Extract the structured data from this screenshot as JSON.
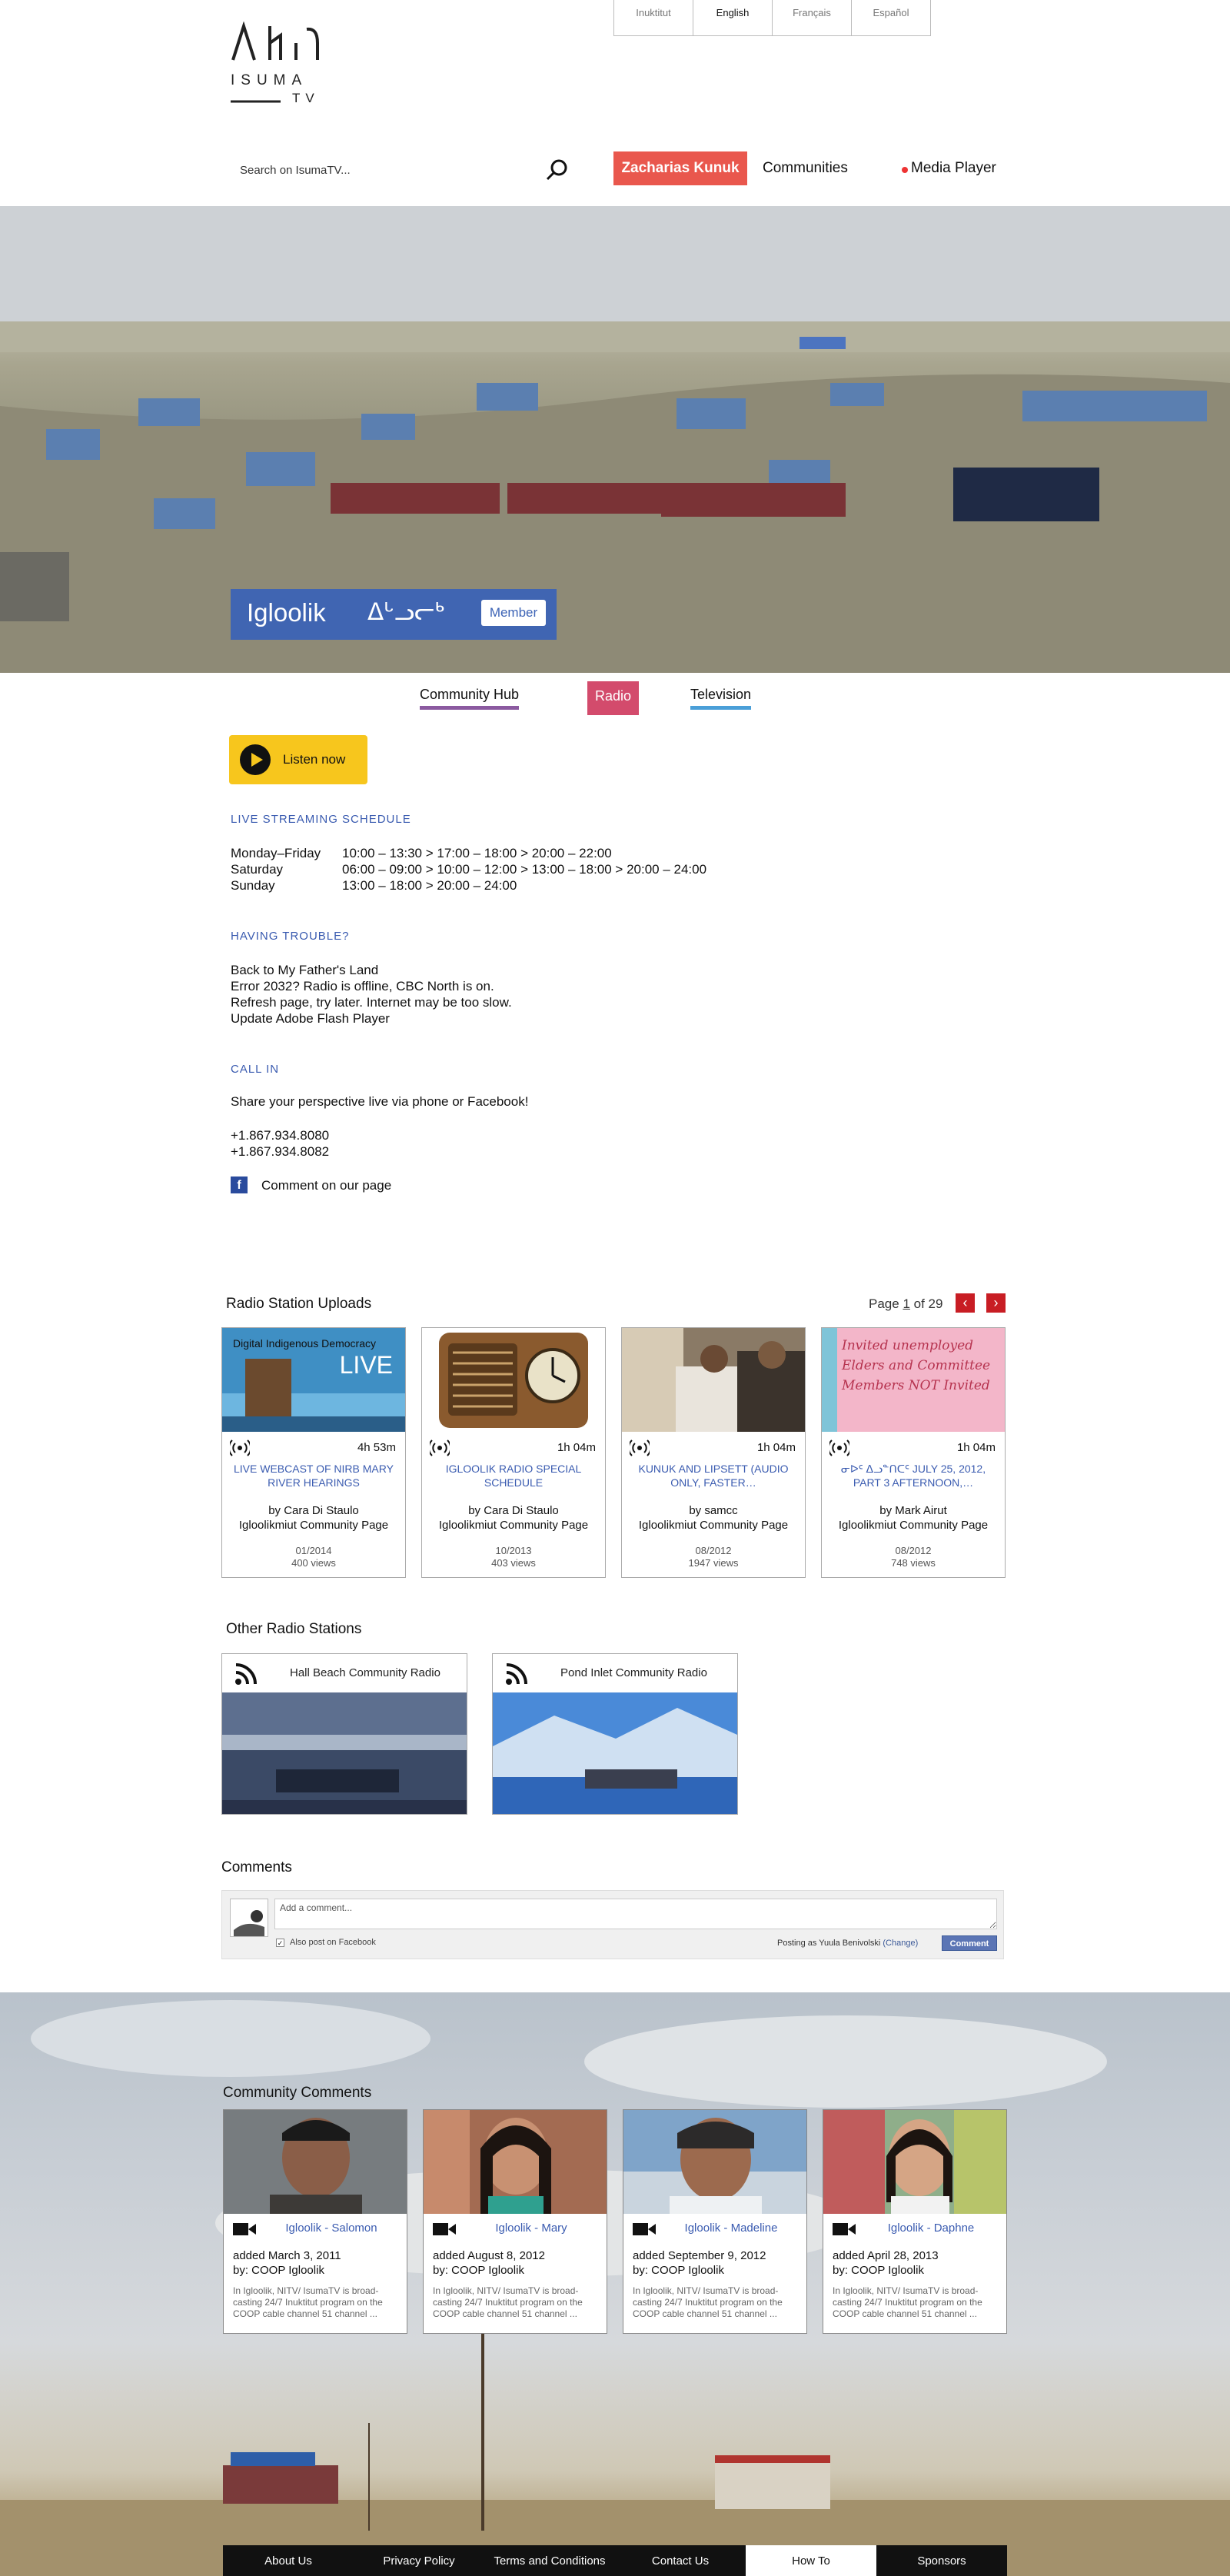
{
  "languages": [
    {
      "label": "Inuktitut",
      "active": false
    },
    {
      "label": "English",
      "active": true
    },
    {
      "label": "Français",
      "active": false
    },
    {
      "label": "Español",
      "active": false
    }
  ],
  "logo": {
    "word": "ISUMA",
    "sub": "TV"
  },
  "search": {
    "placeholder": "Search on IsumaTV..."
  },
  "nav": {
    "user": "Zacharias Kunuk",
    "communities": "Communities",
    "media_player": "Media Player"
  },
  "hero": {
    "title": "Igloolik",
    "syllabics": "ᐃᒡᓗᓕᒃ",
    "member": "Member"
  },
  "tabs": {
    "hub": "Community Hub",
    "radio": "Radio",
    "tv": "Television"
  },
  "listen": {
    "label": "Listen now"
  },
  "schedule": {
    "heading": "LIVE STREAMING SCHEDULE",
    "rows": [
      {
        "day": "Monday–Friday",
        "times": "10:00 – 13:30 > 17:00 – 18:00 > 20:00 – 22:00"
      },
      {
        "day": "Saturday",
        "times": "06:00 – 09:00 > 10:00 – 12:00 > 13:00 – 18:00 > 20:00 – 24:00"
      },
      {
        "day": "Sunday",
        "times": "13:00 – 18:00 > 20:00 – 24:00"
      }
    ]
  },
  "trouble": {
    "heading": "HAVING TROUBLE?",
    "lines": [
      "Back to My Father's Land",
      "Error 2032? Radio is offline, CBC North is on.",
      "Refresh page, try later. Internet may be too slow.",
      "Update Adobe Flash Player"
    ]
  },
  "callin": {
    "heading": "CALL IN",
    "intro": "Share your perspective live via phone or Facebook!",
    "phones": [
      "+1.867.934.8080",
      "+1.867.934.8082"
    ],
    "facebook": "Comment on our page"
  },
  "uploads": {
    "title": "Radio Station Uploads",
    "page_label": "Page",
    "page_current": "1",
    "page_of": "of 29",
    "prev": "‹",
    "next": "›",
    "cards": [
      {
        "thumb_caption": "Digital Indigenous Democracy",
        "thumb_live": "LIVE",
        "duration": "4h 53m",
        "title": "LIVE WEBCAST OF NIRB MARY RIVER HEARINGS",
        "by": "by Cara Di Staulo",
        "community": "Igloolikmiut Community Page",
        "date": "01/2014",
        "views": "400 views"
      },
      {
        "duration": "1h 04m",
        "title": "IGLOOLIK RADIO SPECIAL SCHEDULE",
        "by": "by Cara Di Staulo",
        "community": "Igloolikmiut Community Page",
        "date": "10/2013",
        "views": "403 views"
      },
      {
        "duration": "1h 04m",
        "title": "KUNUK AND LIPSETT (AUDIO ONLY, FASTER…",
        "by": "by samcc",
        "community": "Igloolikmiut Community Page",
        "date": "08/2012",
        "views": "1947 views"
      },
      {
        "thumb_caption": "Invited unemployed Elders and Committee Members NOT Invited",
        "duration": "1h 04m",
        "title": "ᓂᐅᑦ ᐃᓗᓐᑎᑕᑦ JULY 25, 2012, PART 3 AFTERNOON,…",
        "by": "by Mark Airut",
        "community": "Igloolikmiut Community Page",
        "date": "08/2012",
        "views": "748 views"
      }
    ]
  },
  "stations": {
    "title": "Other Radio Stations",
    "items": [
      {
        "name": "Hall Beach Community Radio"
      },
      {
        "name": "Pond Inlet Community Radio"
      }
    ]
  },
  "comments": {
    "title": "Comments",
    "placeholder": "Add a comment...",
    "also_post": "Also post on Facebook",
    "posting_as": "Posting as Yuula Benivolski",
    "change": "(Change)",
    "button": "Comment"
  },
  "community_comments": {
    "title": "Community Comments",
    "items": [
      {
        "name": "Igloolik - Salomon",
        "added": "added March 3, 2011",
        "by": "by: COOP Igloolik",
        "body": "In Igloolik, NITV/ IsumaTV is broad-casting 24/7 Inuktitut program on the COOP cable channel 51 channel ..."
      },
      {
        "name": "Igloolik - Mary",
        "added": "added August 8, 2012",
        "by": "by: COOP Igloolik",
        "body": "In Igloolik, NITV/ IsumaTV is broad-casting 24/7 Inuktitut program on the COOP cable channel 51 channel ..."
      },
      {
        "name": "Igloolik - Madeline",
        "added": "added September  9, 2012",
        "by": "by: COOP Igloolik",
        "body": "In Igloolik, NITV/ IsumaTV is broad-casting 24/7 Inuktitut program on the COOP cable channel 51 channel ..."
      },
      {
        "name": "Igloolik - Daphne",
        "added": "added April 28, 2013",
        "by": "by: COOP Igloolik",
        "body": "In Igloolik, NITV/ IsumaTV is broad-casting 24/7 Inuktitut program on the COOP cable channel 51 channel ..."
      }
    ]
  },
  "footer": {
    "items": [
      {
        "label": "About Us",
        "active": false
      },
      {
        "label": "Privacy Policy",
        "active": false
      },
      {
        "label": "Terms and Conditions",
        "active": false
      },
      {
        "label": "Contact Us",
        "active": false
      },
      {
        "label": "How To",
        "active": true
      },
      {
        "label": "Sponsors",
        "active": false
      }
    ]
  },
  "colors": {
    "accent_blue": "#3a5bb0",
    "user_red": "#e9574d",
    "radio_pink": "#d34b6c",
    "listen_yellow": "#f7c61d",
    "pager_red": "#c81d24"
  }
}
